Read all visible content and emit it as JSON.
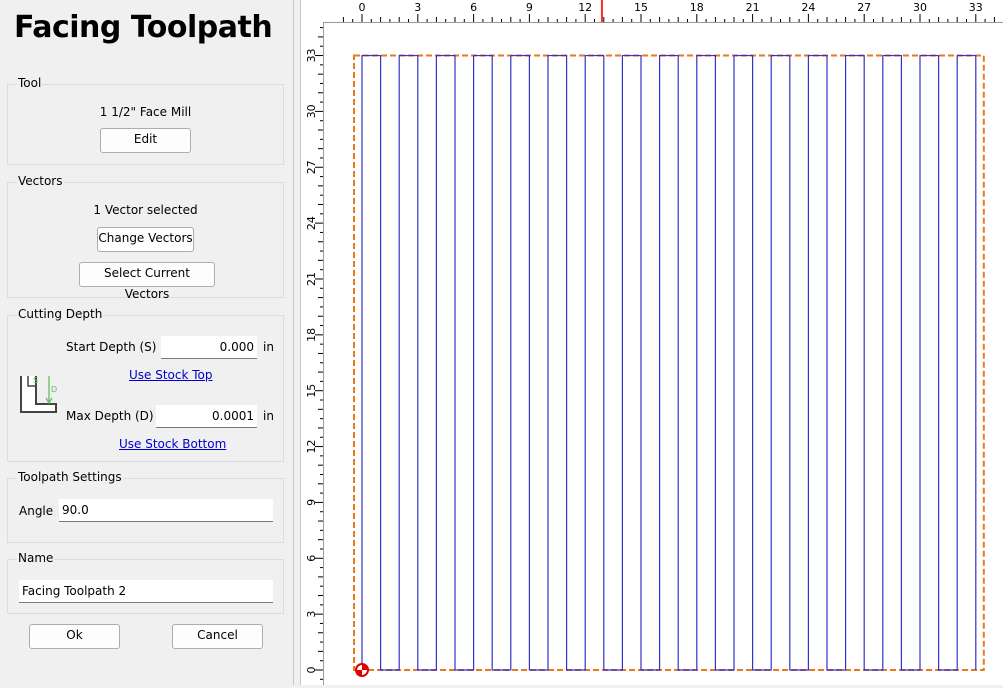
{
  "title": "Facing Toolpath",
  "tool": {
    "group_label": "Tool",
    "name": "1 1/2\" Face Mill",
    "edit_label": "Edit"
  },
  "vectors": {
    "group_label": "Vectors",
    "status": "1 Vector selected",
    "change_label": "Change Vectors",
    "select_current_label": "Select Current Vectors"
  },
  "cutting_depth": {
    "group_label": "Cutting Depth",
    "start_label": "Start Depth (S)",
    "start_value": "0.000",
    "start_unit": "in",
    "use_stock_top": "Use Stock Top",
    "max_label": "Max Depth (D)",
    "max_value": "0.0001",
    "max_unit": "in",
    "use_stock_bottom": "Use Stock Bottom",
    "diagram_s": "S",
    "diagram_d": "D"
  },
  "settings": {
    "group_label": "Toolpath Settings",
    "angle_label": "Angle",
    "angle_value": "90.0"
  },
  "name_group": {
    "group_label": "Name",
    "value": "Facing Toolpath 2"
  },
  "buttons": {
    "ok": "Ok",
    "cancel": "Cancel"
  },
  "ruler": {
    "h_labels": [
      "0",
      "3",
      "6",
      "9",
      "12",
      "15",
      "18",
      "21",
      "24",
      "27",
      "30",
      "33"
    ],
    "v_labels": [
      "0",
      "3",
      "6",
      "9",
      "12",
      "15",
      "18",
      "21",
      "24",
      "27",
      "30",
      "33"
    ],
    "marker_at": 12.9
  },
  "toolpath": {
    "passes": 34,
    "extent": [
      0,
      33
    ],
    "stock_color": "#e87a1e",
    "path_color": "#3333cc",
    "cursor_marker_color": "#ff2a2a",
    "origin_marker_color": "#e00000"
  }
}
